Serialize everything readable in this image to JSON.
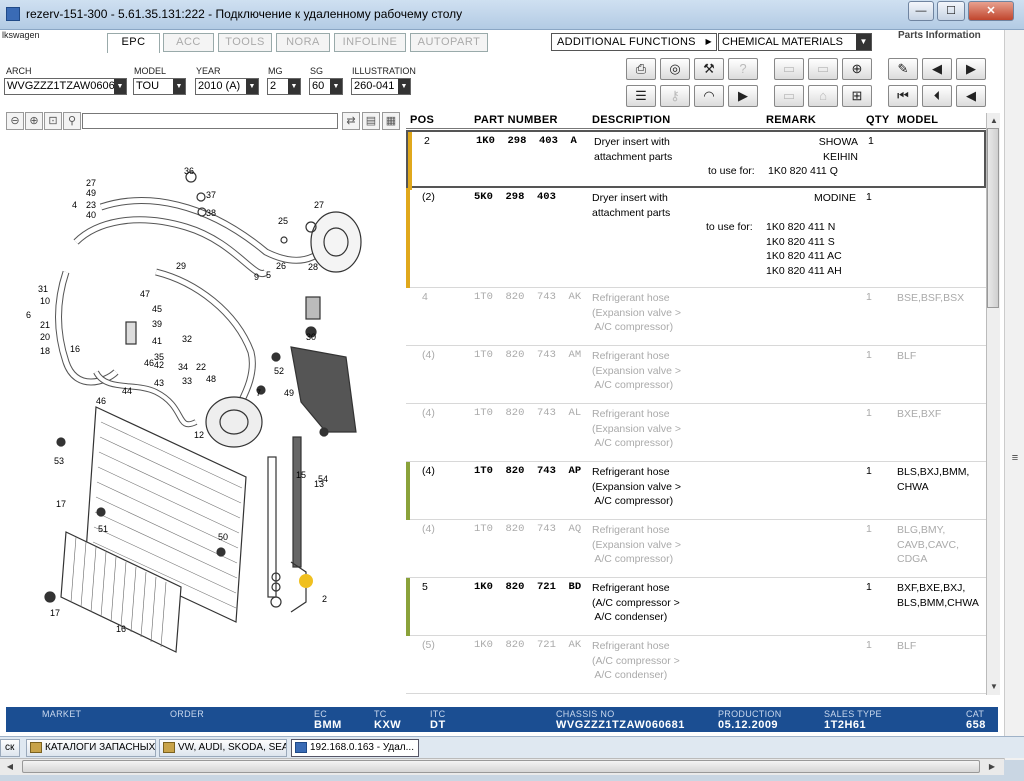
{
  "window": {
    "title": "rezerv-151-300 - 5.61.35.131:222 - Подключение к удаленному рабочему столу",
    "min_label": "—",
    "max_label": "☐",
    "close_label": "✕"
  },
  "brand": "lkswagen",
  "parts_info": "Parts Information",
  "tabs": [
    {
      "label": "EPC"
    },
    {
      "label": "ACC"
    },
    {
      "label": "TOOLS"
    },
    {
      "label": "NORA"
    },
    {
      "label": "INFOLINE"
    },
    {
      "label": "AUTOPART"
    }
  ],
  "additional_functions": "ADDITIONAL FUNCTIONS",
  "chemical_materials": "CHEMICAL MATERIALS",
  "filters": {
    "search": {
      "label": "ARCH",
      "value": "WVGZZZ1TZAW06068"
    },
    "model": {
      "label": "MODEL",
      "value": "TOU"
    },
    "year": {
      "label": "YEAR",
      "value": "2010 (A)"
    },
    "mg": {
      "label": "MG",
      "value": "2"
    },
    "sg": {
      "label": "SG",
      "value": "60"
    },
    "illustration": {
      "label": "ILLUSTRATION",
      "value": "260-041"
    }
  },
  "table": {
    "headers": {
      "pos": "POS",
      "part": "PART NUMBER",
      "desc": "DESCRIPTION",
      "remark": "REMARK",
      "qty": "QTY",
      "model": "MODEL"
    },
    "rows": [
      {
        "pos": "2",
        "pn": "1K0  298  403  A",
        "desc": "Dryer insert with\nattachment parts",
        "remark": "SHOWA\nKEIHIN",
        "use_for": "to use for:",
        "use_vals": "1K0 820 411 Q",
        "qty": "1",
        "model": "",
        "bar": "#e0a81c",
        "dim": false,
        "sel": true
      },
      {
        "pos": "(2)",
        "pn": "5K0  298  403",
        "desc": "Dryer insert with\nattachment parts",
        "remark": "MODINE",
        "use_for": "to use for:",
        "use_vals": "1K0 820 411 N\n1K0 820 411 S\n1K0 820 411 AC\n1K0 820 411 AH",
        "qty": "1",
        "model": "",
        "bar": "#e0a81c",
        "dim": false,
        "sel": false
      },
      {
        "pos": "4",
        "pn": "1T0  820  743  AK",
        "desc": "Refrigerant hose\n(Expansion valve >\n A/C compressor)",
        "remark": "",
        "use_for": "",
        "use_vals": "",
        "qty": "1",
        "model": "BSE,BSF,BSX",
        "bar": "",
        "dim": true,
        "sel": false
      },
      {
        "pos": "(4)",
        "pn": "1T0  820  743  AM",
        "desc": "Refrigerant hose\n(Expansion valve >\n A/C compressor)",
        "remark": "",
        "use_for": "",
        "use_vals": "",
        "qty": "1",
        "model": "BLF",
        "bar": "",
        "dim": true,
        "sel": false
      },
      {
        "pos": "(4)",
        "pn": "1T0  820  743  AL",
        "desc": "Refrigerant hose\n(Expansion valve >\n A/C compressor)",
        "remark": "",
        "use_for": "",
        "use_vals": "",
        "qty": "1",
        "model": "BXE,BXF",
        "bar": "",
        "dim": true,
        "sel": false
      },
      {
        "pos": "(4)",
        "pn": "1T0  820  743  AP",
        "desc": "Refrigerant hose\n(Expansion valve >\n A/C compressor)",
        "remark": "",
        "use_for": "",
        "use_vals": "",
        "qty": "1",
        "model": "BLS,BXJ,BMM,\nCHWA",
        "bar": "#8aa23a",
        "dim": false,
        "sel": false
      },
      {
        "pos": "(4)",
        "pn": "1T0  820  743  AQ",
        "desc": "Refrigerant hose\n(Expansion valve >\n A/C compressor)",
        "remark": "",
        "use_for": "",
        "use_vals": "",
        "qty": "1",
        "model": "BLG,BMY,\nCAVB,CAVC,\nCDGA",
        "bar": "",
        "dim": true,
        "sel": false
      },
      {
        "pos": "5",
        "pn": "1K0  820  721  BD",
        "desc": "Refrigerant hose\n(A/C compressor >\n A/C condenser)",
        "remark": "",
        "use_for": "",
        "use_vals": "",
        "qty": "1",
        "model": "BXF,BXE,BXJ,\nBLS,BMM,CHWA",
        "bar": "#8aa23a",
        "dim": false,
        "sel": false
      },
      {
        "pos": "(5)",
        "pn": "1K0  820  721  AK",
        "desc": "Refrigerant hose\n(A/C compressor >\n A/C condenser)",
        "remark": "",
        "use_for": "",
        "use_vals": "",
        "qty": "1",
        "model": "BLF",
        "bar": "",
        "dim": true,
        "sel": false
      }
    ]
  },
  "footer": {
    "market": {
      "label": "MARKET",
      "value": ""
    },
    "order": {
      "label": "ORDER",
      "value": ""
    },
    "ec": {
      "label": "EC",
      "value": "BMM"
    },
    "tc": {
      "label": "TC",
      "value": "KXW"
    },
    "itc": {
      "label": "ITC",
      "value": "DT"
    },
    "chassis": {
      "label": "CHASSIS NO",
      "value": "WVGZZZ1TZAW060681"
    },
    "production": {
      "label": "PRODUCTION",
      "value": "05.12.2009"
    },
    "sales_type": {
      "label": "SALES TYPE",
      "value": "1T2H61"
    },
    "cat": {
      "label": "CAT",
      "value": "658"
    }
  },
  "taskbar": [
    {
      "label": "ск"
    },
    {
      "label": "КАТАЛОГИ ЗАПАСНЫХ ..."
    },
    {
      "label": "VW, AUDI, SKODA, SEAT"
    },
    {
      "label": "192.168.0.163 - Удал..."
    }
  ],
  "diagram_labels": [
    "36",
    "37",
    "38",
    "27",
    "49",
    "4",
    "23",
    "40",
    "25",
    "27",
    "5",
    "6",
    "9",
    "26",
    "28",
    "29",
    "30",
    "31",
    "10",
    "21",
    "20",
    "18",
    "16",
    "35",
    "47",
    "45",
    "39",
    "41",
    "42",
    "43",
    "33",
    "32",
    "34",
    "22",
    "46",
    "44",
    "46",
    "48",
    "7",
    "49",
    "52",
    "54",
    "12",
    "13",
    "53",
    "17",
    "51",
    "50",
    "17",
    "16",
    "15",
    "2",
    "1",
    "11",
    "2",
    "3"
  ]
}
